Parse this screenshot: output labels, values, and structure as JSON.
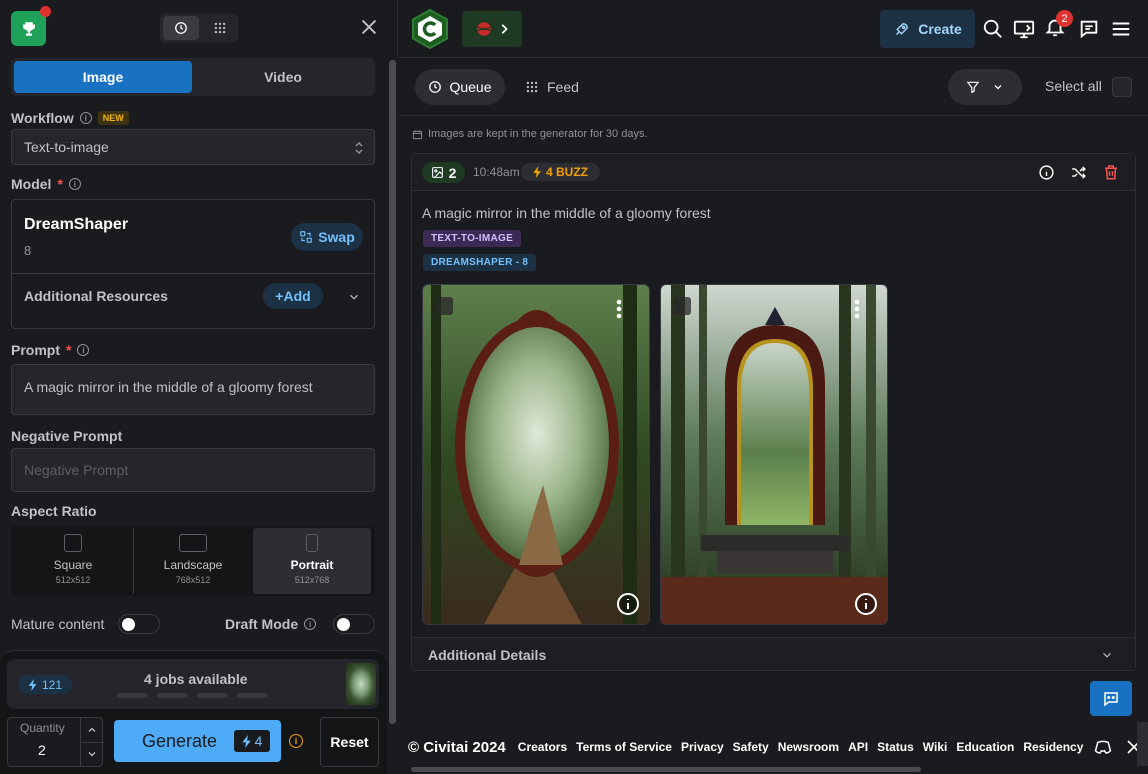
{
  "generator": {
    "mode_tabs": [
      "Image",
      "Video"
    ],
    "workflow": {
      "label": "Workflow",
      "badge": "NEW",
      "value": "Text-to-image"
    },
    "model": {
      "label": "Model",
      "required": "*",
      "name": "DreamShaper",
      "version": "8",
      "swap_label": "Swap"
    },
    "additional_resources": {
      "label": "Additional Resources",
      "add_label": "+Add"
    },
    "prompt": {
      "label": "Prompt",
      "required": "*",
      "value": "A magic mirror in the middle of a gloomy forest"
    },
    "negative_prompt": {
      "label": "Negative Prompt",
      "placeholder": "Negative Prompt"
    },
    "aspect_ratio": {
      "label": "Aspect Ratio",
      "options": [
        {
          "title": "Square",
          "size": "512x512"
        },
        {
          "title": "Landscape",
          "size": "768x512"
        },
        {
          "title": "Portrait",
          "size": "512x768"
        }
      ],
      "selected": "Portrait"
    },
    "mature_content": {
      "label": "Mature content",
      "on": false
    },
    "draft_mode": {
      "label": "Draft Mode",
      "on": false
    },
    "buzz_balance": "121",
    "jobs_available": "4 jobs available",
    "quantity": {
      "label": "Quantity",
      "value": "2"
    },
    "generate": {
      "label": "Generate",
      "cost": "4"
    },
    "reset_label": "Reset"
  },
  "header": {
    "create_label": "Create",
    "notification_count": "2"
  },
  "queue": {
    "queue_label": "Queue",
    "feed_label": "Feed",
    "select_all_label": "Select all",
    "notice": "Images are kept in the generator for 30 days.",
    "job": {
      "image_count": "2",
      "time": "10:48am",
      "buzz": "4 BUZZ",
      "prompt": "A magic mirror in the middle of a gloomy forest",
      "tags": [
        "TEXT-TO-IMAGE",
        "DREAMSHAPER - 8"
      ],
      "additional_details_label": "Additional Details"
    }
  },
  "footer": {
    "copyright": "© Civitai 2024",
    "links": [
      "Creators",
      "Terms of Service",
      "Privacy",
      "Safety",
      "Newsroom",
      "API",
      "Status",
      "Wiki",
      "Education",
      "Residency"
    ]
  },
  "colors": {
    "accent": "#1971c2",
    "generate": "#4dabf7",
    "buzz": "#f59f00",
    "bg": "#1a1b1e"
  }
}
